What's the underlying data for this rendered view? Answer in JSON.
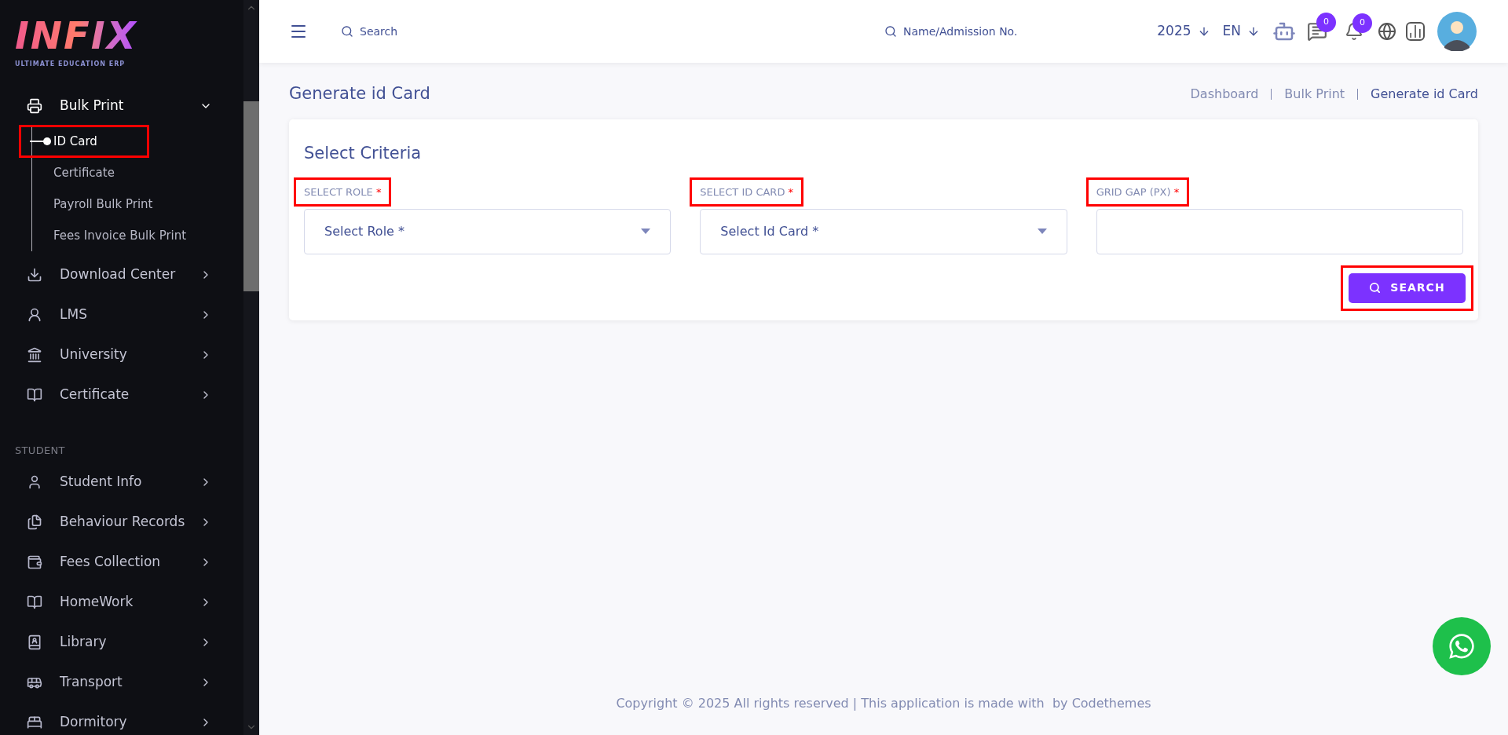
{
  "logo": {
    "text": "INFIX",
    "tagline": "ULTIMATE EDUCATION ERP"
  },
  "sidebar": {
    "items": [
      {
        "kind": "menu",
        "label": "Bulk Print",
        "expanded": true,
        "children": [
          {
            "label": "ID Card",
            "selected": true,
            "highlighted": true
          },
          {
            "label": "Certificate",
            "selected": false,
            "highlighted": false
          },
          {
            "label": "Payroll Bulk Print",
            "selected": false,
            "highlighted": false
          },
          {
            "label": "Fees Invoice Bulk Print",
            "selected": false,
            "highlighted": false
          }
        ]
      },
      {
        "kind": "menu",
        "label": "Download Center",
        "expanded": false
      },
      {
        "kind": "menu",
        "label": "LMS",
        "expanded": false
      },
      {
        "kind": "menu",
        "label": "University",
        "expanded": false
      },
      {
        "kind": "menu",
        "label": "Certificate",
        "expanded": false
      },
      {
        "kind": "section",
        "label": "STUDENT"
      },
      {
        "kind": "menu",
        "label": "Student Info",
        "expanded": false
      },
      {
        "kind": "menu",
        "label": "Behaviour Records",
        "expanded": false
      },
      {
        "kind": "menu",
        "label": "Fees Collection",
        "expanded": false
      },
      {
        "kind": "menu",
        "label": "HomeWork",
        "expanded": false
      },
      {
        "kind": "menu",
        "label": "Library",
        "expanded": false
      },
      {
        "kind": "menu",
        "label": "Transport",
        "expanded": false
      },
      {
        "kind": "menu",
        "label": "Dormitory",
        "expanded": false
      }
    ]
  },
  "header": {
    "search": {
      "placeholder": "Search"
    },
    "student_search": {
      "placeholder": "Name/Admission No."
    },
    "year": "2025",
    "language": "EN",
    "messages_badge": "0",
    "notifications_badge": "0"
  },
  "page_title": "Generate id Card",
  "breadcrumb": [
    {
      "label": "Dashboard",
      "selected": false
    },
    {
      "label": "Bulk Print",
      "selected": false
    },
    {
      "label": "Generate id Card",
      "selected": true
    }
  ],
  "card": {
    "title": "Select Criteria",
    "fields": [
      {
        "kind": "select",
        "label": "SELECT ROLE",
        "required_mark": "*",
        "placeholder": "Select Role *",
        "highlighted": true
      },
      {
        "kind": "select",
        "label": "SELECT ID CARD",
        "required_mark": "*",
        "placeholder": "Select Id Card *",
        "highlighted": true
      },
      {
        "kind": "text",
        "label": "GRID GAP (PX)",
        "required_mark": "*",
        "highlighted": true
      }
    ],
    "button": {
      "label": "SEARCH",
      "highlighted": true
    }
  },
  "footer": "Copyright © 2025 All rights reserved | This application is made with  by Codethemes"
}
